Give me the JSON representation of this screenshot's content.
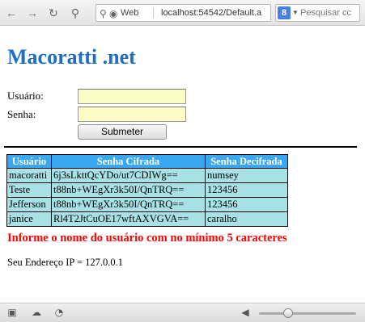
{
  "browser": {
    "address": {
      "security_label": "Web",
      "url": "localhost:54542/Default.a"
    },
    "search": {
      "engine_letter": "8",
      "placeholder": "Pesquisar cc"
    }
  },
  "page": {
    "title": "Macoratti .net",
    "form": {
      "username_label": "Usuário:",
      "username_value": "",
      "password_label": "Senha:",
      "password_value": "",
      "submit_label": "Submeter"
    },
    "table": {
      "headers": [
        "Usuário",
        "Senha Cifrada",
        "Senha Decifrada"
      ],
      "rows": [
        [
          "macoratti",
          "6j3sLkttQcYDo/ut7CDIWg==",
          "numsey"
        ],
        [
          "Teste",
          "t88nb+WEgXr3k50I/QnTRQ==",
          "123456"
        ],
        [
          "Jefferson",
          "t88nb+WEgXr3k50I/QnTRQ==",
          "123456"
        ],
        [
          "janice",
          "Rl4T2JtCuOE17wftAXVGVA==",
          "caralho"
        ]
      ]
    },
    "warning": "Informe o nome do usuário com no mínimo 5 caracteres",
    "ip_line": "Seu Endereço IP = 127.0.0.1"
  },
  "statusbar": {
    "zoom_fraction": 0.3
  },
  "colors": {
    "title": "#1e6ec8",
    "header_bg": "#3aa7f2",
    "cell_bg": "#a8e2e6",
    "warning": "#ff0000",
    "input_bg": "#fdfdc8"
  }
}
